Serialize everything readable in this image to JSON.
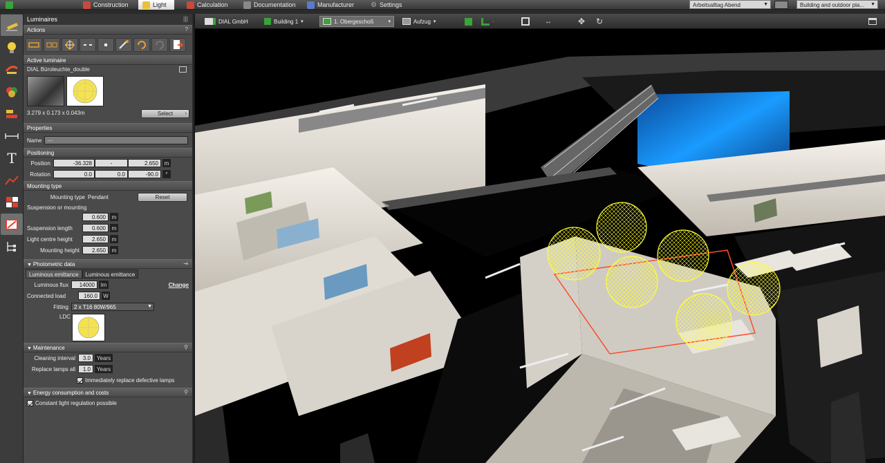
{
  "tabs": [
    {
      "label": "",
      "icon": "save-icon",
      "color": "#3aa33a"
    },
    {
      "label": "Construction",
      "icon": "building-icon",
      "color": "#c94a3a"
    },
    {
      "label": "Light",
      "icon": "lamp-icon",
      "color": "#e8c23a"
    },
    {
      "label": "Calculation",
      "icon": "calculator-icon",
      "color": "#c94a3a"
    },
    {
      "label": "Documentation",
      "icon": "document-icon",
      "color": "#888888"
    },
    {
      "label": "Manufacturer",
      "icon": "manufacturer-icon",
      "color": "#5a7ac9"
    },
    {
      "label": "Settings",
      "icon": "gear-icon",
      "color": "#aaaaaa"
    }
  ],
  "scene_select": "Arbeitsalltag Abend",
  "mode_select": "Building and outdoor pla...",
  "panel": {
    "title": "Luminaires",
    "actions": {
      "title": "Actions",
      "help": "?"
    },
    "active": {
      "title": "Active luminaire",
      "name": "DIAL Büroleuchte_double",
      "dims": "3.279 x 0.173 x 0.043m",
      "select_label": "Select"
    },
    "properties": {
      "title": "Properties",
      "name_label": "Name",
      "name_value": "---"
    },
    "positioning": {
      "title": "Positioning",
      "position_label": "Position",
      "position": [
        "-36.328",
        "-",
        "2.650"
      ],
      "position_unit": "m",
      "rotation_label": "Rotation",
      "rotation": [
        "0.0",
        "0.0",
        "-90.0"
      ],
      "rotation_unit": "°"
    },
    "mounting": {
      "title": "Mounting type",
      "type_label": "Mounting type",
      "type_value": "Pendant",
      "reset_label": "Reset",
      "suspension_or_mounting_label": "Suspension or mounting",
      "suspension_or_mounting": "0.600",
      "suspension_length_label": "Suspension length",
      "suspension_length": "0.600",
      "centre_height_label": "Light centre height",
      "centre_height": "2.650",
      "mounting_height_label": "Mounting height",
      "mounting_height": "2.650",
      "unit": "m"
    },
    "photometric": {
      "title": "Photometric data",
      "tab1": "Luminous emittance",
      "tab2": "Luminous emittance",
      "flux_label": "Luminous flux",
      "flux": "14000",
      "flux_unit": "lm",
      "change_label": "Change",
      "load_label": "Connected load",
      "load": "160.0",
      "load_unit": "W",
      "fitting_label": "Fitting",
      "fitting": "2 x T16 80W/965",
      "ldc_label": "LDC"
    },
    "maintenance": {
      "title": "Maintenance",
      "cleaning_label": "Cleaning interval",
      "cleaning": "3.0",
      "cleaning_unit": "Years",
      "replace_label": "Replace lamps all",
      "replace": "1.0",
      "replace_unit": "Years",
      "immediately_label": "Immediately replace defective lamps"
    },
    "energy": {
      "title": "Energy consumption and costs",
      "constant_label": "Constant light regulation possible"
    }
  },
  "viewbar": {
    "company": "DIAL GmbH",
    "building": "Building 1",
    "floor": "1. Obergeschoß",
    "elevator": "Aufzug"
  },
  "colors": {
    "sphere": "#ffff33",
    "blue_glow": "#1a9bff",
    "wall": "#e8e4dc"
  }
}
